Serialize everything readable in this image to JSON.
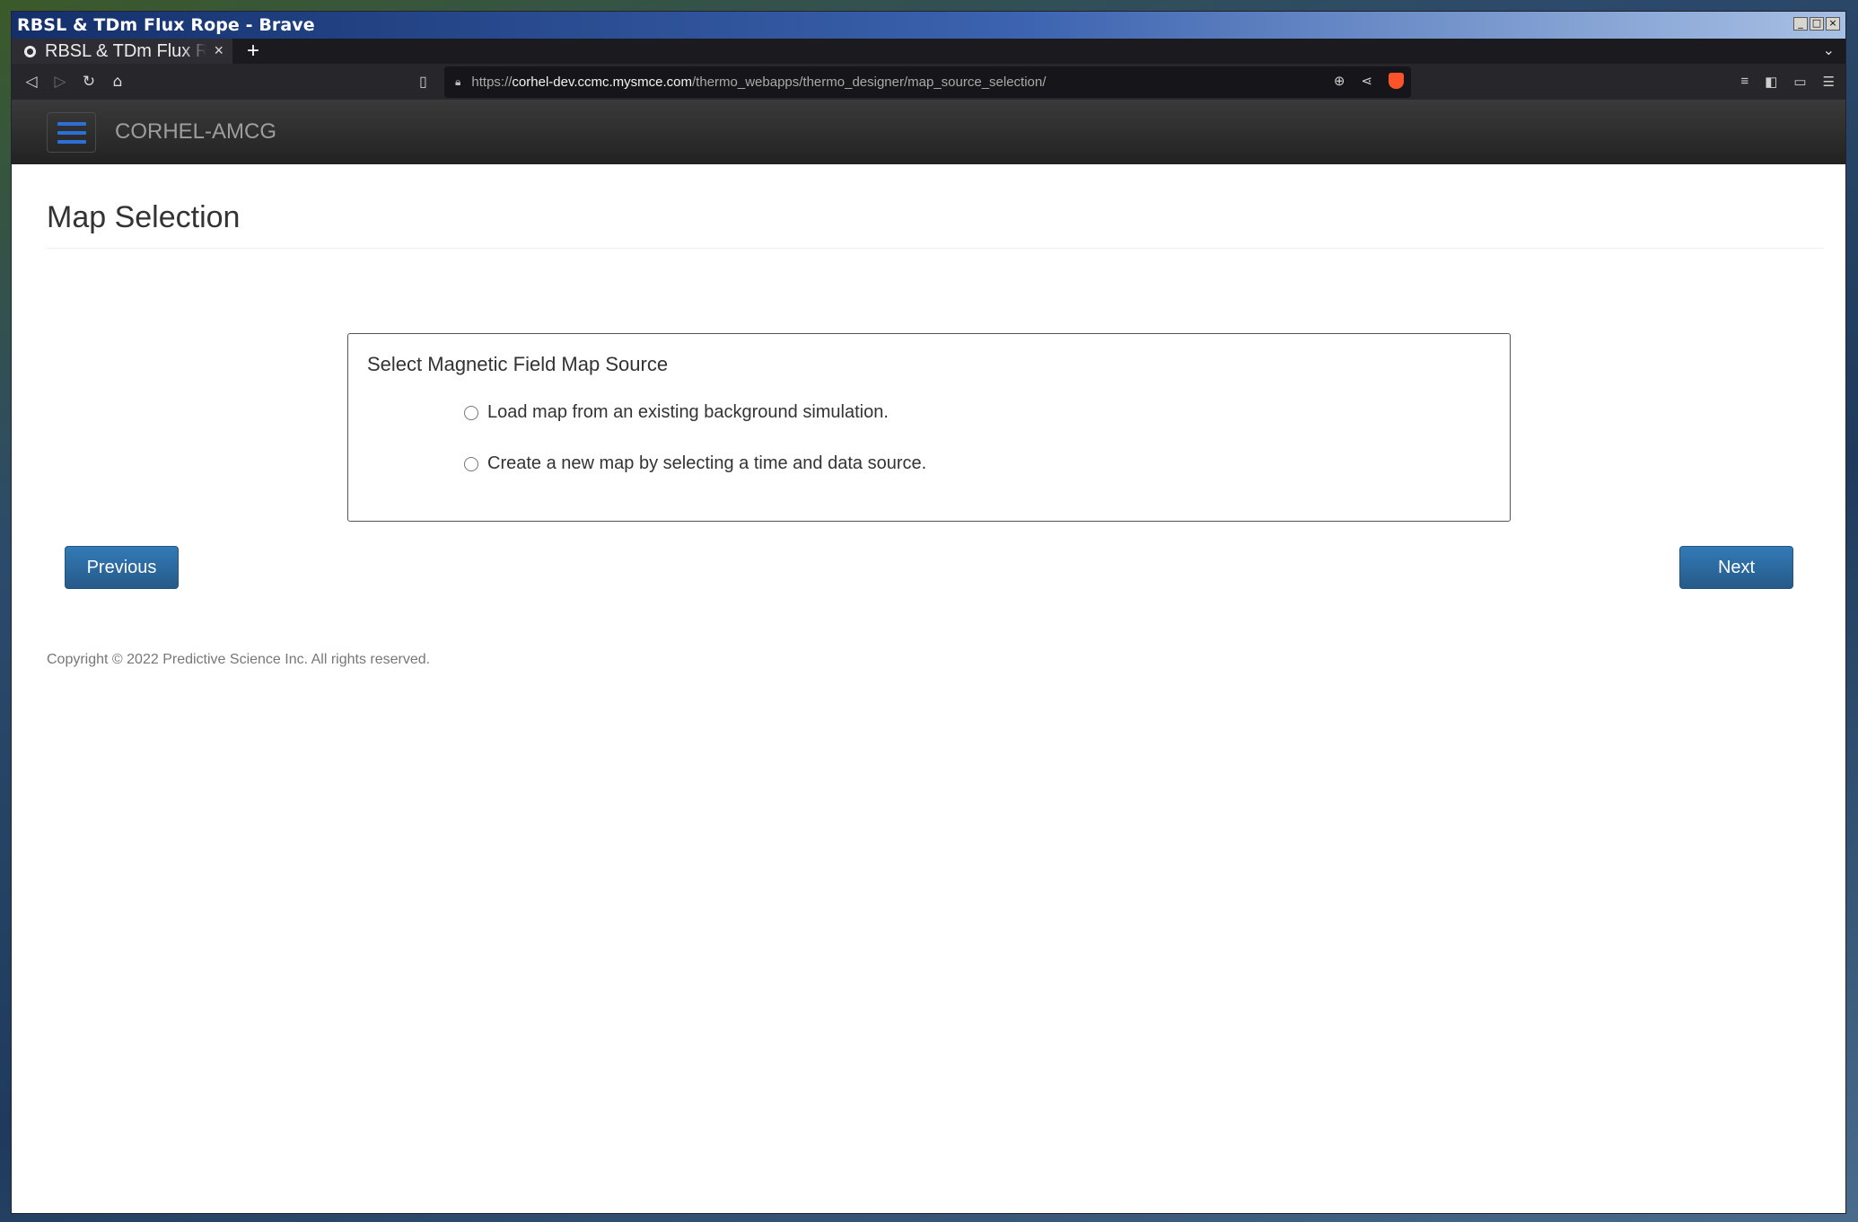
{
  "window": {
    "title": "RBSL & TDm Flux Rope - Brave",
    "controls": [
      "minimize",
      "maximize",
      "close"
    ]
  },
  "tabs": [
    {
      "label": "RBSL & TDm Flux R",
      "active": true
    }
  ],
  "toolbar": {
    "url_prefix": "https://",
    "url_host": "corhel-dev.ccmc.mysmce.com",
    "url_path": "/thermo_webapps/thermo_designer/map_source_selection/"
  },
  "navbar": {
    "brand": "CORHEL-AMCG",
    "menu_icon": "hamburger-icon",
    "accent_color": "#2d6fd6"
  },
  "page": {
    "title": "Map Selection",
    "panel": {
      "title": "Select Magnetic Field Map Source",
      "options": [
        {
          "label": "Load map from an existing background simulation.",
          "selected": false
        },
        {
          "label": "Create a new map by selecting a time and data source.",
          "selected": false
        }
      ]
    },
    "buttons": {
      "previous": "Previous",
      "next": "Next",
      "color": "#337ab7"
    },
    "footer": "Copyright © 2022 Predictive Science Inc. All rights reserved."
  }
}
